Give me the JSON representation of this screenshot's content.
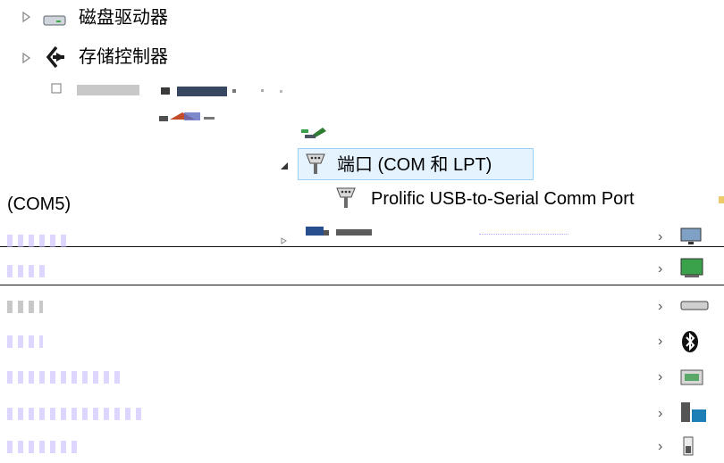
{
  "tree": {
    "disk_drives": {
      "label": "磁盘驱动器",
      "icon": "disk-drive-icon"
    },
    "storage_controllers": {
      "label": "存储控制器",
      "icon": "storage-controller-icon"
    },
    "ports": {
      "label": "端口 (COM 和 LPT)",
      "icon": "serial-port-icon"
    },
    "prolific_device": {
      "label": "Prolific USB-to-Serial Comm Port",
      "icon": "serial-port-icon"
    },
    "prolific_suffix": {
      "label": "(COM5)"
    }
  },
  "colors": {
    "selection_bg": "#e5f3ff",
    "selection_border": "#99d1ff",
    "expander": "#8a8a8a",
    "ghost_text": "#6a5cff"
  }
}
